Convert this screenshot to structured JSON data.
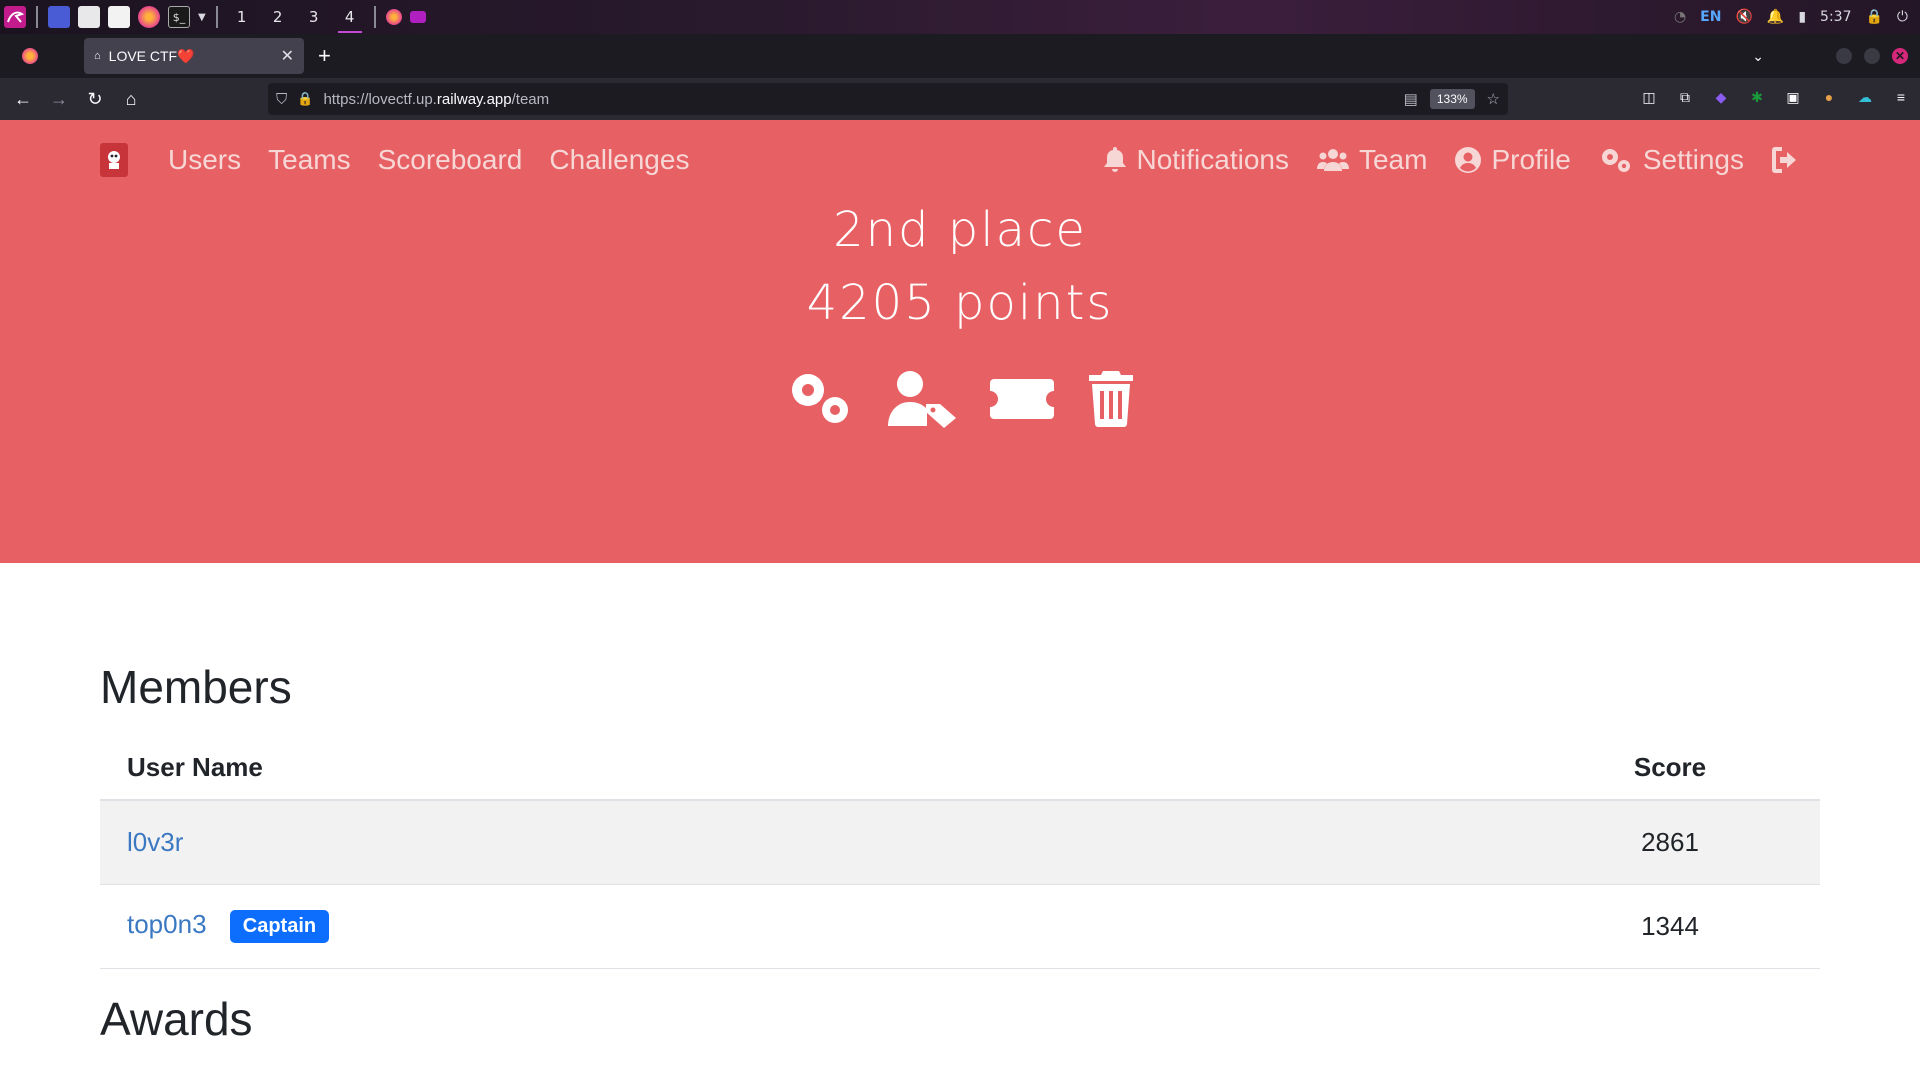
{
  "os": {
    "workspaces": [
      "1",
      "2",
      "3",
      "4"
    ],
    "active_workspace": "4",
    "lang": "EN",
    "clock": "5:37"
  },
  "browser": {
    "tab_title": "LOVE CTF❤️",
    "url_prefix": "https://lovectf.up.",
    "url_host": "railway.app",
    "url_path": "/team",
    "zoom": "133%"
  },
  "site_nav": {
    "left": [
      "Users",
      "Teams",
      "Scoreboard",
      "Challenges"
    ],
    "notifications": "Notifications",
    "team": "Team",
    "profile": "Profile",
    "settings": "Settings"
  },
  "team": {
    "place": "2nd place",
    "points": "4205 points"
  },
  "members": {
    "title": "Members",
    "headers": {
      "user": "User Name",
      "score": "Score"
    },
    "rows": [
      {
        "name": "l0v3r",
        "score": "2861",
        "badge": ""
      },
      {
        "name": "top0n3",
        "score": "1344",
        "badge": "Captain"
      }
    ]
  },
  "awards": {
    "title": "Awards"
  },
  "colors": {
    "hero": "#e76063",
    "link": "#3b78c2",
    "badge": "#0d6efd"
  }
}
